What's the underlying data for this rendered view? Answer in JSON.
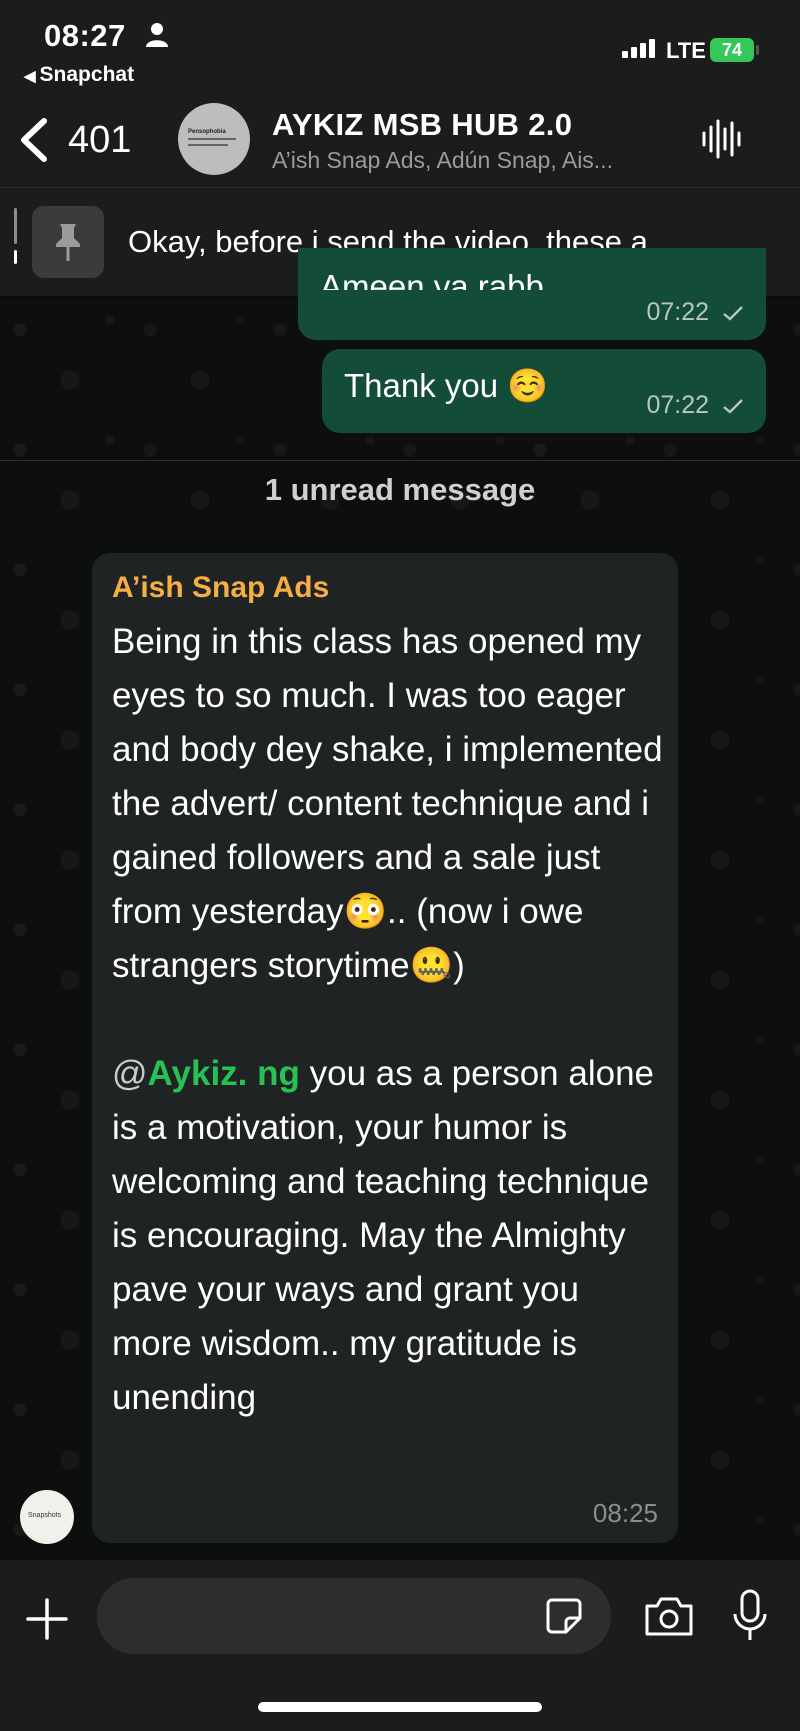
{
  "status_bar": {
    "time": "08:27",
    "back_app": "Snapchat",
    "network": "LTE",
    "battery": "74"
  },
  "header": {
    "back_count": "401",
    "title": "AYKIZ MSB HUB 2.0",
    "subtitle": "A’ish Snap Ads, Adún Snap, Ais...",
    "avatar_text": "Pensophobia"
  },
  "pinned": {
    "text": "Okay, before i send the video, these a..."
  },
  "messages_out": [
    {
      "text": "Ameen ya rabb",
      "time": "07:22"
    },
    {
      "text": "Thank you ☺️",
      "time": "07:22"
    }
  ],
  "unread_label": "1 unread message",
  "message_in": {
    "sender": "A’ish Snap Ads",
    "paragraph1": "Being in this class has opened my eyes to so much.  I was too eager and body dey shake, i implemented the advert/ content technique and i gained followers and a sale just from yesterday😳.. (now i owe strangers storytime🤐)",
    "mention_prefix": "@",
    "mention": "Aykiz. ng",
    "paragraph2": " you as a person alone is a motivation, your humor is welcoming and teaching technique is encouraging. May the Almighty pave your ways and grant you more wisdom.. my gratitude is unending",
    "time": "08:25",
    "avatar_text": "Snapshots"
  },
  "input": {
    "placeholder": ""
  },
  "colors": {
    "outgoing_bubble": "#144d37",
    "incoming_bubble": "#202323",
    "sender_name": "#f4ae43",
    "mention": "#27c254",
    "battery": "#34c759"
  }
}
